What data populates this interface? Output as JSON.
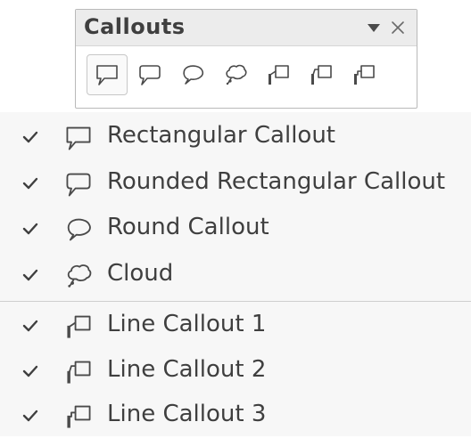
{
  "toolbar": {
    "title": "Callouts",
    "buttons": [
      {
        "icon": "rectangular-callout-icon",
        "active": true
      },
      {
        "icon": "rounded-rectangular-callout-icon",
        "active": false
      },
      {
        "icon": "round-callout-icon",
        "active": false
      },
      {
        "icon": "cloud-callout-icon",
        "active": false
      },
      {
        "icon": "line-callout-1-icon",
        "active": false
      },
      {
        "icon": "line-callout-2-icon",
        "active": false
      },
      {
        "icon": "line-callout-3-icon",
        "active": false
      }
    ]
  },
  "menu": {
    "items": [
      {
        "label": "Rectangular Callout",
        "checked": true,
        "icon": "rectangular-callout-icon"
      },
      {
        "label": "Rounded Rectangular Callout",
        "checked": true,
        "icon": "rounded-rectangular-callout-icon"
      },
      {
        "label": "Round Callout",
        "checked": true,
        "icon": "round-callout-icon"
      },
      {
        "label": "Cloud",
        "checked": true,
        "icon": "cloud-callout-icon"
      },
      {
        "label": "Line Callout 1",
        "checked": true,
        "icon": "line-callout-1-icon"
      },
      {
        "label": "Line Callout 2",
        "checked": true,
        "icon": "line-callout-2-icon"
      },
      {
        "label": "Line Callout 3",
        "checked": true,
        "icon": "line-callout-3-icon"
      }
    ]
  },
  "colors": {
    "text": "#3f3f3f",
    "menu_background": "#f7f7f7",
    "toolbar_header": "#ececec"
  }
}
